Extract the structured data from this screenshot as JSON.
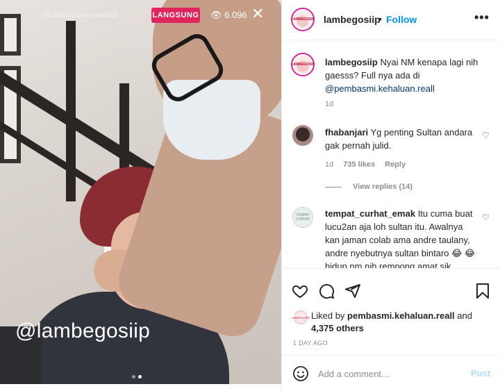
{
  "media": {
    "live_username": "nikitamirzanimawardi",
    "live_badge": "LANGSUNG",
    "live_viewers": "6.096",
    "close_glyph": "✕",
    "watermark": "@lambegosiip",
    "carousel_index": 2,
    "carousel_total": 2
  },
  "header": {
    "avatar_label": "LAMBEGOSIP",
    "username": "lambegosiip",
    "separator": "•",
    "follow_label": "Follow",
    "more_icon": "•••"
  },
  "caption": {
    "username": "lambegosiip",
    "text": "Nyai NM kenapa lagi nih gaesss? Full nya ada di",
    "mention": "@pembasmi.kehaluan.reall",
    "time": "1d"
  },
  "comments": [
    {
      "username": "fhabanjari",
      "text": "Yg penting Sultan andara gak pernah julid.",
      "time": "1d",
      "likes": "735 likes",
      "reply_label": "Reply",
      "view_replies": "View replies (14)"
    },
    {
      "username": "tempat_curhat_emak",
      "avatar_label": "TEMPAT CURHAT",
      "text": "Itu cuma buat lucu2an aja loh sultan itu. Awalnya kan jaman colab ama andre taulany, andre nyebutnya sultan bintaro 😂 😂 hidup nm nih rempong amat sik,"
    }
  ],
  "actions": {
    "icons": [
      "heart-icon",
      "comment-icon",
      "share-icon",
      "bookmark-icon"
    ],
    "liked_by_prefix": "Liked by",
    "liked_by_user": "pembasmi.kehaluan.reall",
    "liked_by_and": "and",
    "liked_by_others": "4,375 others",
    "post_age": "1 DAY AGO"
  },
  "comment_bar": {
    "placeholder": "Add a comment…",
    "post_label": "Post"
  },
  "colors": {
    "accent": "#0095f6",
    "live_badge": "#e0245e",
    "mention": "#00376b",
    "muted": "#8e8e8e"
  }
}
